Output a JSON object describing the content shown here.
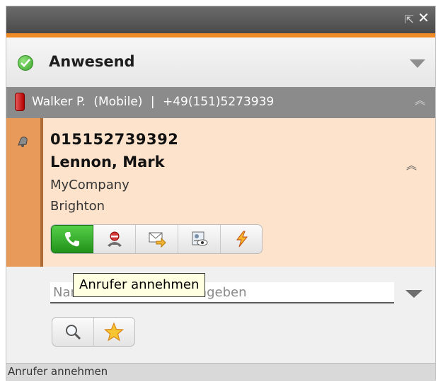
{
  "window": {
    "titlebar_controls": [
      "restore-icon",
      "close-icon"
    ]
  },
  "presence": {
    "label": "Anwesend",
    "icon": "check-icon"
  },
  "active_call": {
    "name": "Walker P.",
    "device": "(Mobile)",
    "separator": "|",
    "number": "+49(151)5273939"
  },
  "caller": {
    "number": "015152739392",
    "name": "Lennon, Mark",
    "company": "MyCompany",
    "city": "Brighton"
  },
  "actions": [
    "answer-call",
    "reject-call",
    "forward-mail",
    "contact-view",
    "lightning"
  ],
  "search": {
    "placeholder": "Name oder Nummer eingeben"
  },
  "tooltip": {
    "text": "Anrufer annehmen"
  },
  "statusbar": {
    "text": "Anrufer annehmen"
  },
  "colors": {
    "accent_orange": "#f08a24",
    "card_background": "#fde3cc",
    "stripe": "#e89a5a",
    "answer_green": "#2ea824"
  }
}
